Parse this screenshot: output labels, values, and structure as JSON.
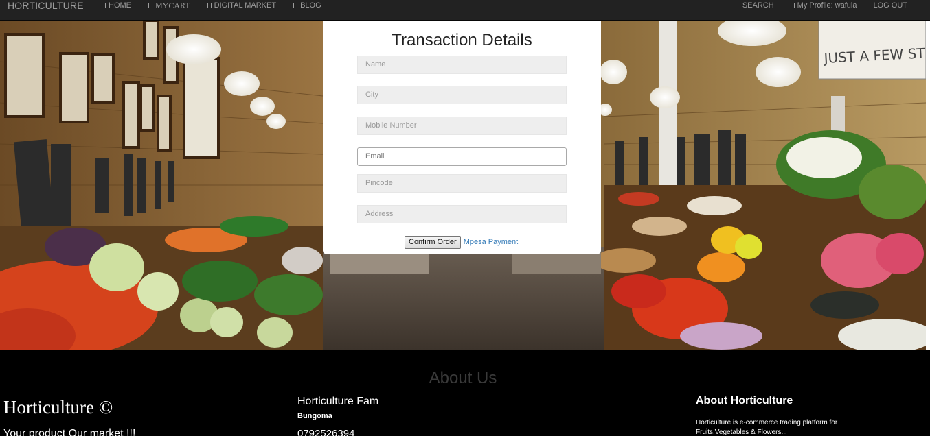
{
  "navbar": {
    "brand": "HORTICULTURE",
    "left_items": [
      {
        "label": "HOME",
        "icon": "home-icon"
      },
      {
        "label": "MYCART",
        "icon": "cart-icon"
      },
      {
        "label": "DIGITAL MARKET",
        "icon": "market-icon"
      },
      {
        "label": "BLOG",
        "icon": "blog-icon"
      }
    ],
    "search_label": "SEARCH",
    "profile_label": "My Profile: wafula",
    "profile_icon": "user-icon",
    "logout_label": "LOG OUT"
  },
  "form": {
    "title": "Transaction Details",
    "fields": [
      {
        "name": "name",
        "placeholder": "Name"
      },
      {
        "name": "city",
        "placeholder": "City"
      },
      {
        "name": "mobile",
        "placeholder": "Mobile Number"
      },
      {
        "name": "email",
        "placeholder": "Email"
      },
      {
        "name": "pincode",
        "placeholder": "Pincode"
      },
      {
        "name": "address",
        "placeholder": "Address"
      }
    ],
    "confirm_label": "Confirm Order",
    "mpesa_label": "Mpesa Payment"
  },
  "hero": {
    "sign_text": "JUST A FEW STEP"
  },
  "footer": {
    "about_heading": "About Us",
    "col1": {
      "title": "Horticulture ©",
      "subtitle": "Your product Our market !!!"
    },
    "col2": {
      "title": "Horticulture Fam",
      "city": "Bungoma",
      "phone": "0792526394"
    },
    "col3": {
      "title": "About Horticulture",
      "description": "Horticulture is e-commerce trading platform for Fruits,Vegetables & Flowers..."
    }
  },
  "colors": {
    "navbar_bg": "#222222",
    "nav_text": "#9d9d9d",
    "link": "#337ab7",
    "footer_bg": "#000000"
  }
}
